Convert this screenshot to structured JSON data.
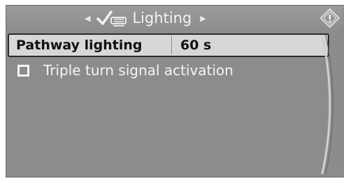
{
  "header": {
    "title": "Lighting",
    "left_arrow_icon": "triangle-left-icon",
    "right_arrow_icon": "triangle-right-icon",
    "category_icon": "check-vehicle-icon",
    "info_icon": "info-icon"
  },
  "menu": {
    "items": [
      {
        "label": "Pathway lighting",
        "value": "60 s",
        "selected": true
      },
      {
        "label": "Triple turn signal activation",
        "checked": false
      }
    ]
  },
  "colors": {
    "screen_bg": "#8c8c8c",
    "selected_row_bg": "#d7d7d7",
    "text_light": "#f4f4f4",
    "text_dark": "#111111"
  }
}
